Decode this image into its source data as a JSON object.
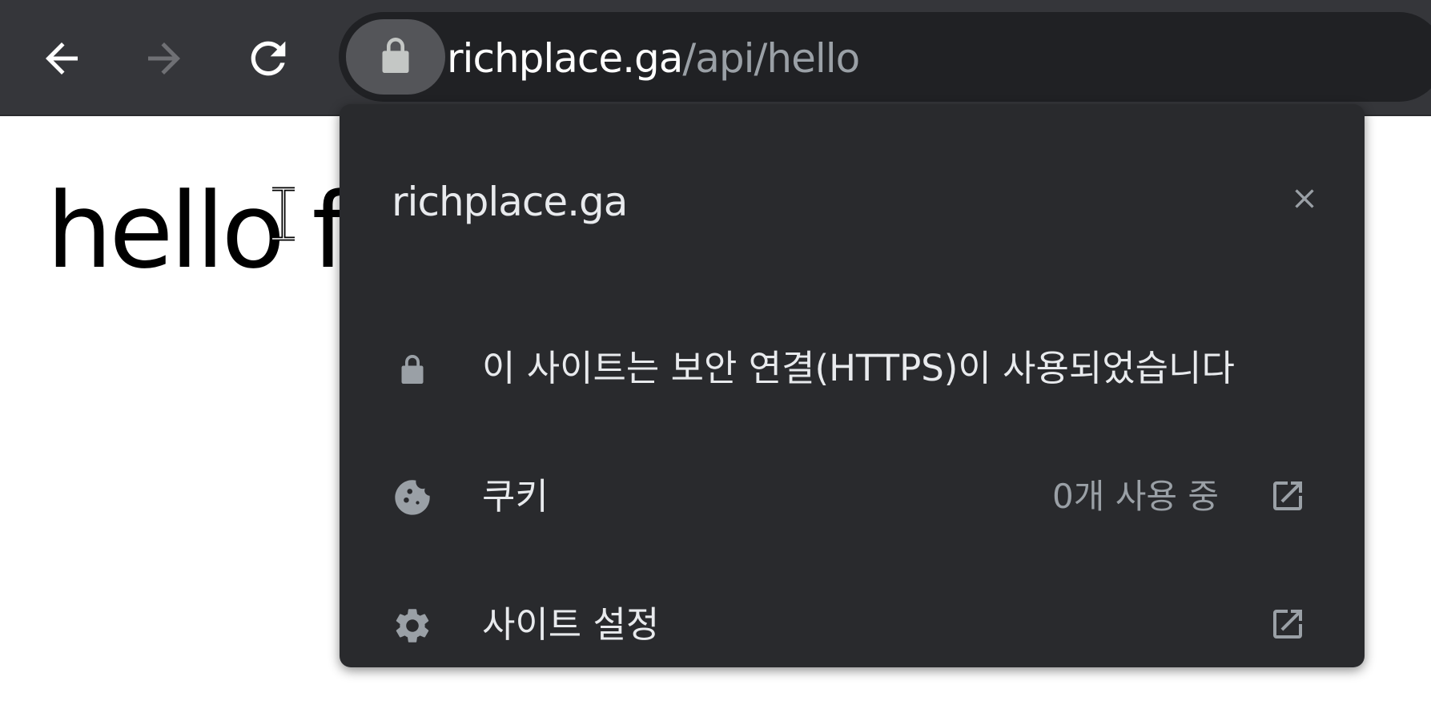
{
  "toolbar": {
    "back_icon": "arrow-left-icon",
    "forward_icon": "arrow-right-icon",
    "reload_icon": "reload-icon",
    "lock_icon": "lock-icon",
    "url_host": "richplace.ga",
    "url_path": "/api/hello"
  },
  "page": {
    "text": "hello f"
  },
  "site_info_popup": {
    "title": "richplace.ga",
    "close_icon": "close-icon",
    "connection": {
      "icon": "lock-icon",
      "label": "이 사이트는 보안 연결(HTTPS)이 사용되었습니다"
    },
    "cookies": {
      "icon": "cookie-icon",
      "label": "쿠키",
      "value": "0개 사용 중",
      "ext_icon": "open-in-new-icon"
    },
    "site_settings": {
      "icon": "gear-icon",
      "label": "사이트 설정",
      "ext_icon": "open-in-new-icon"
    }
  },
  "colors": {
    "toolbar_bg": "#35363a",
    "omnibox_bg": "#202124",
    "popup_bg": "#292a2d",
    "text_primary": "#e8eaed",
    "text_secondary": "#9aa0a6",
    "icon": "#9aa0a6"
  }
}
